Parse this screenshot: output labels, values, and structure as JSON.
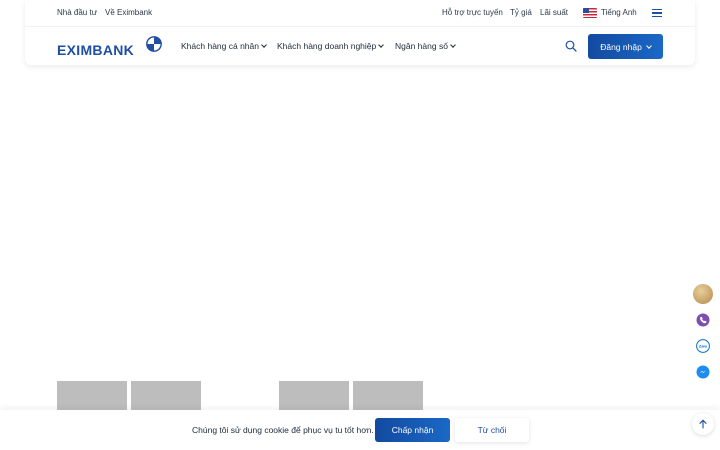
{
  "topbar": {
    "left_links": [
      "Nhà đầu tư",
      "Về Eximbank"
    ],
    "right_links": [
      "Hỗ trợ trực tuyến",
      "Tỷ giá",
      "Lãi suất"
    ],
    "language": "Tiếng Anh",
    "flag_icon": "us-flag-icon",
    "menu_icon": "hamburger-menu-icon"
  },
  "nav": {
    "logo_text": "EXIMBANK",
    "items": [
      "Khách hàng cá nhân",
      "Khách hàng doanh nghiệp",
      "Ngân hàng số"
    ],
    "search_icon": "search-icon",
    "login_label": "Đăng nhập"
  },
  "side_icons": [
    "avatar-icon",
    "viber-icon",
    "zalo-icon",
    "messenger-icon",
    "scroll-top-icon"
  ],
  "cookie": {
    "text": "Chúng tôi sử dụng cookie để phục vụ tu tốt hơn.",
    "accept_label": "Chấp nhận",
    "decline_label": "Từ chối"
  },
  "colors": {
    "brand_blue": "#1f4fa3",
    "button_gradient_start": "#134aa0",
    "button_gradient_end": "#1a68c6",
    "placeholder_gray": "#bdbdbd"
  }
}
